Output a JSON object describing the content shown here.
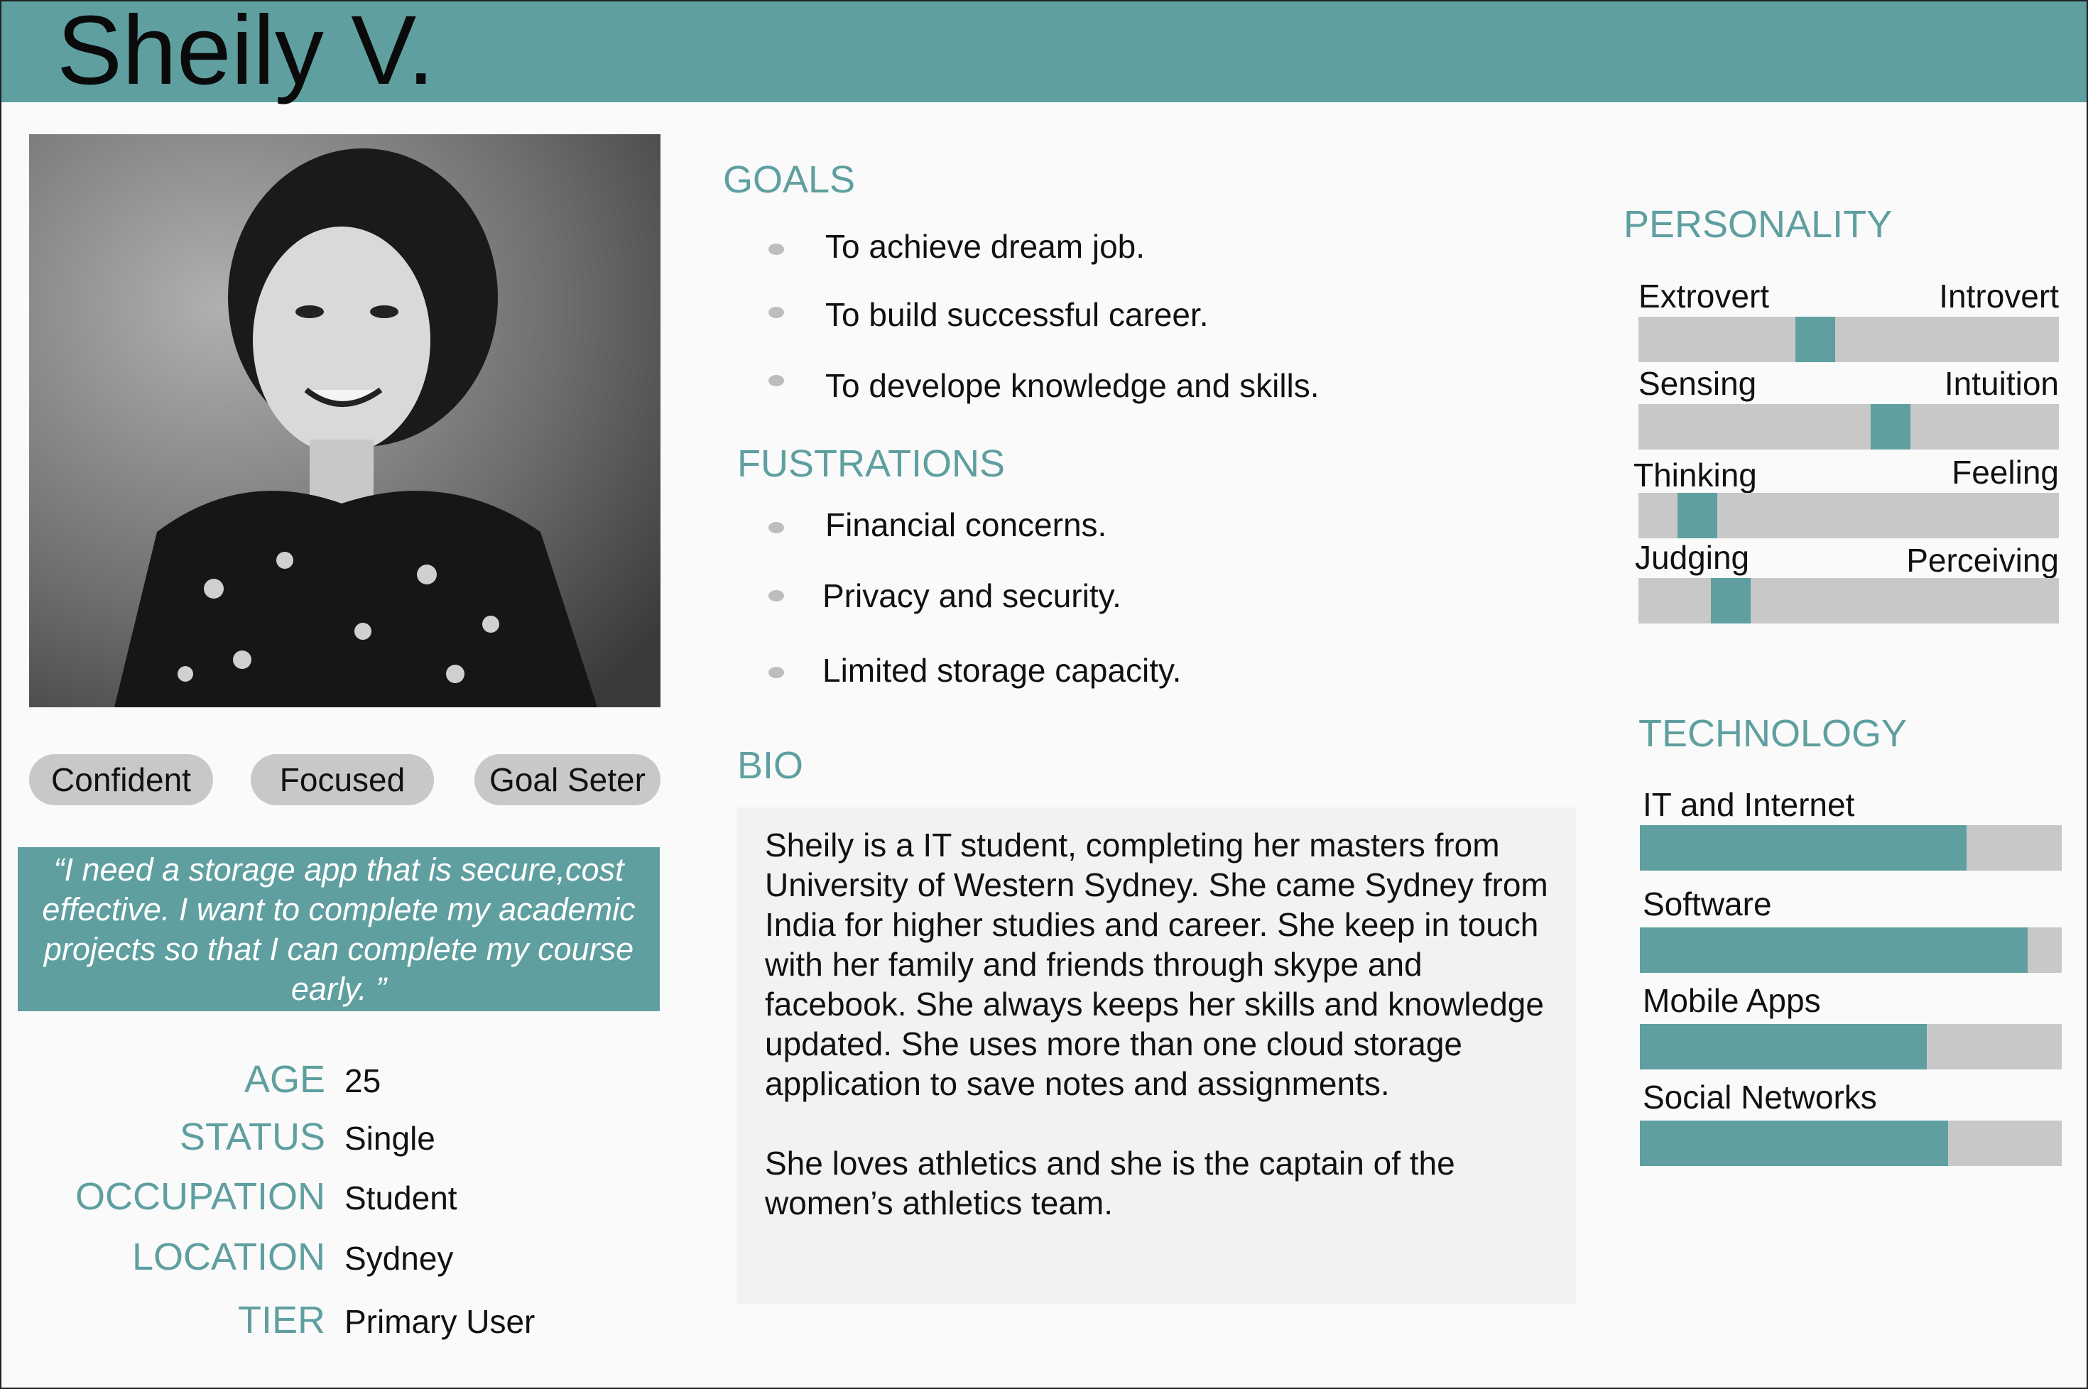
{
  "persona": {
    "name": "Sheily V."
  },
  "photo": {
    "alt": "Black and white portrait photo of Sheily"
  },
  "traits": [
    "Confident",
    "Focused",
    "Goal Seter"
  ],
  "quote": "“I need a storage app that is secure,cost effective. I want to complete my academic projects so that I can complete my course early. ”",
  "info": [
    {
      "label": "AGE",
      "value": "25"
    },
    {
      "label": "STATUS",
      "value": "Single"
    },
    {
      "label": "OCCUPATION",
      "value": "Student"
    },
    {
      "label": "LOCATION",
      "value": "Sydney"
    },
    {
      "label": "TIER",
      "value": "Primary User"
    }
  ],
  "goals": {
    "title": "GOALS",
    "items": [
      "To achieve dream job.",
      "To build successful career.",
      "To develope knowledge and skills."
    ]
  },
  "frustrations": {
    "title": "FUSTRATIONS",
    "items": [
      "Financial concerns.",
      "Privacy and security.",
      "Limited storage capacity."
    ]
  },
  "bio": {
    "title": "BIO",
    "paragraphs": [
      "Sheily is a IT student, completing her masters from University of Western Sydney. She came Sydney from India for higher studies and career. She keep in touch with her family and friends through skype and facebook. She always keeps her skills and knowledge updated. She uses more than one cloud storage application to save notes and assignments.",
      "She loves athletics and she is the captain of the women’s athletics team."
    ]
  },
  "personality": {
    "title": "PERSONALITY",
    "scales": [
      {
        "left": "Extrovert",
        "right": "Introvert",
        "value": 0.42
      },
      {
        "left": "Sensing",
        "right": "Intuition",
        "value": 0.6
      },
      {
        "left": "Thinking",
        "right": "Feeling",
        "value": 0.14
      },
      {
        "left": "Judging",
        "right": "Perceiving",
        "value": 0.22
      }
    ],
    "accent_color": "#5f9fa0"
  },
  "technology": {
    "title": "TECHNOLOGY",
    "items": [
      {
        "label": "IT and Internet",
        "value": 0.775
      },
      {
        "label": "Software",
        "value": 0.92
      },
      {
        "label": "Mobile Apps",
        "value": 0.68
      },
      {
        "label": "Social Networks",
        "value": 0.73
      }
    ]
  },
  "colors": {
    "accent": "#5f9fa0",
    "track": "#c8c8c8",
    "bio_bg": "#f2f2f2"
  }
}
